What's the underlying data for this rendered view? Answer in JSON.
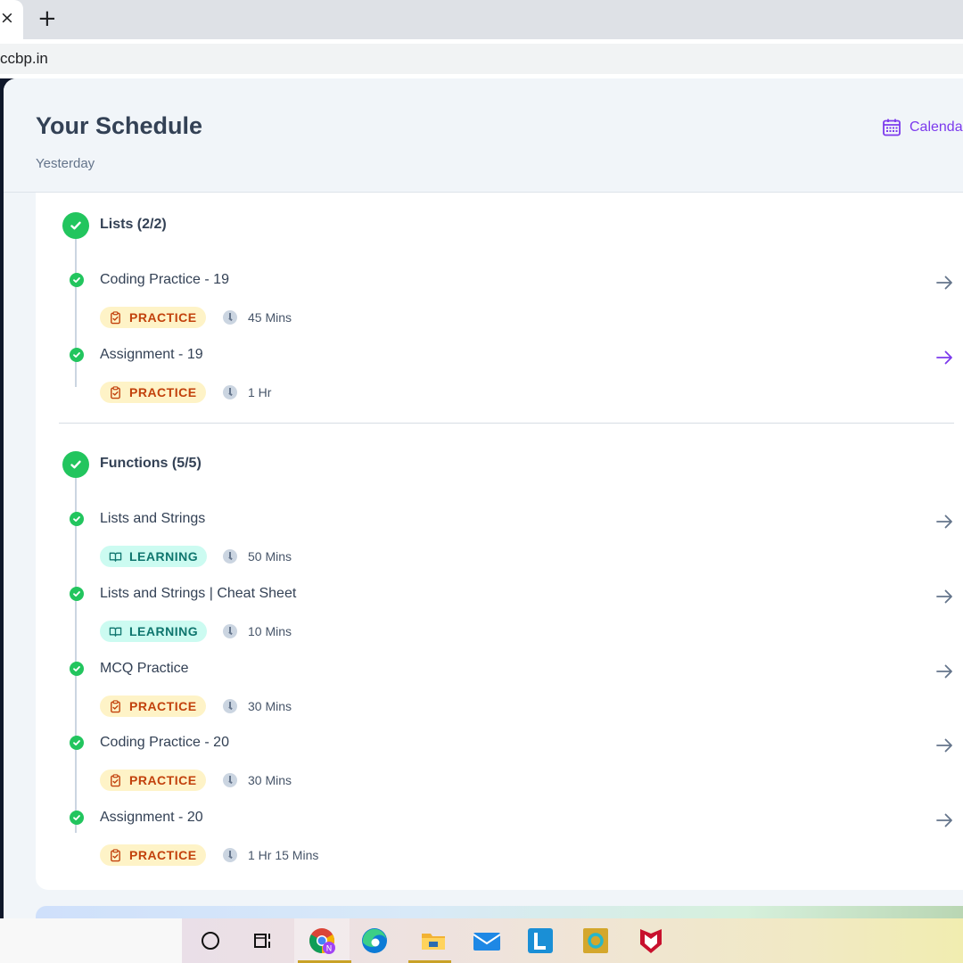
{
  "browser": {
    "tab_close": "×",
    "new_tab": "+",
    "url": "ccbp.in"
  },
  "header": {
    "title": "Your Schedule",
    "subtitle": "Yesterday",
    "calendar_label": "Calendar"
  },
  "sections": [
    {
      "title": "Lists (2/2)",
      "items": [
        {
          "title": "Coding Practice - 19",
          "badge": "PRACTICE",
          "duration": "45 Mins"
        },
        {
          "title": "Assignment - 19",
          "badge": "PRACTICE",
          "duration": "1 Hr"
        }
      ]
    },
    {
      "title": "Functions (5/5)",
      "items": [
        {
          "title": "Lists and Strings",
          "badge": "LEARNING",
          "duration": "50 Mins"
        },
        {
          "title": "Lists and Strings | Cheat Sheet",
          "badge": "LEARNING",
          "duration": "10 Mins"
        },
        {
          "title": "MCQ Practice",
          "badge": "PRACTICE",
          "duration": "30 Mins"
        },
        {
          "title": "Coding Practice - 20",
          "badge": "PRACTICE",
          "duration": "30 Mins"
        },
        {
          "title": "Assignment - 20",
          "badge": "PRACTICE",
          "duration": "1 Hr 15 Mins"
        }
      ]
    }
  ],
  "colors": {
    "accent": "#7c3aed",
    "complete": "#22c55e",
    "practice_bg": "#fef3c7",
    "practice_text": "#c2410c",
    "learning_bg": "#ccfbf1",
    "learning_text": "#0f766e"
  },
  "icons": {
    "calendar": "calendar-icon",
    "check": "check-icon",
    "arrow": "arrow-right-icon",
    "practice": "clipboard-icon",
    "learning": "book-open-icon",
    "duration": "clock-icon"
  }
}
